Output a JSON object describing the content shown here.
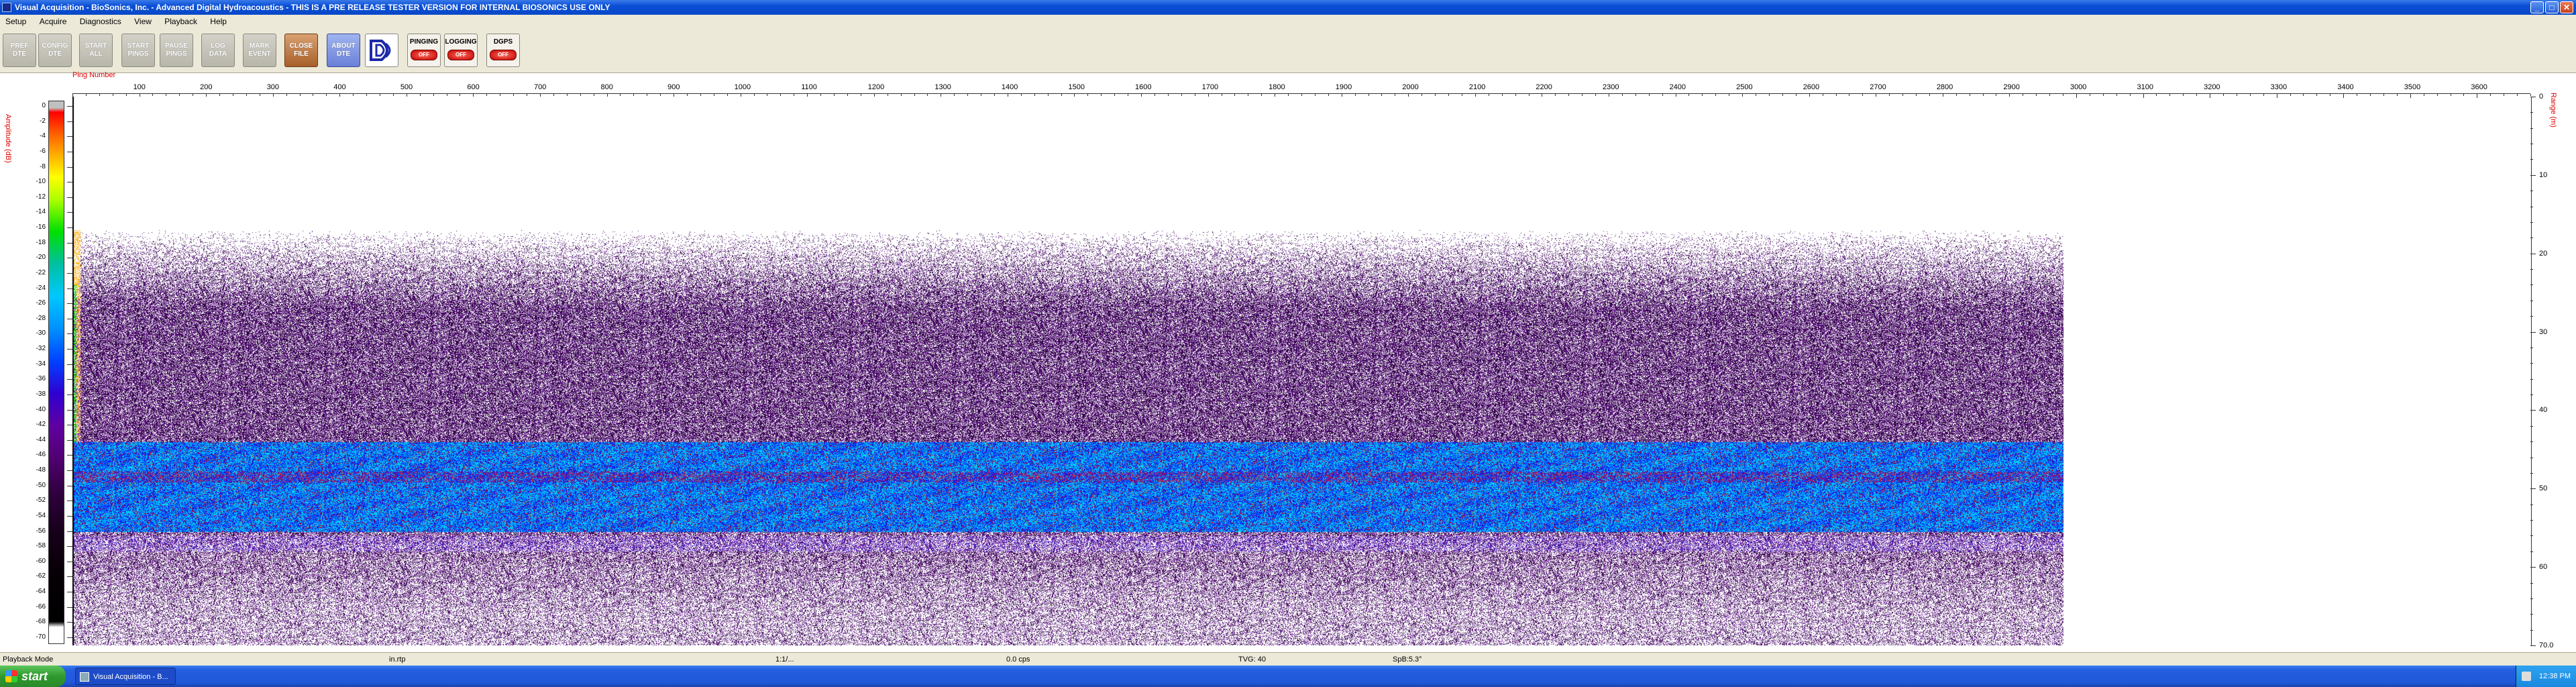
{
  "window": {
    "title": "Visual Acquisition  -  BioSonics, Inc.  -  Advanced Digital Hydroacoustics  -  THIS IS A PRE RELEASE TESTER VERSION FOR INTERNAL BIOSONICS USE ONLY",
    "minimize": "_",
    "maximize": "□",
    "close": "✕"
  },
  "menu": [
    "Setup",
    "Acquire",
    "Diagnostics",
    "View",
    "Playback",
    "Help"
  ],
  "toolbar": {
    "buttons": [
      {
        "id": "pref-dte",
        "line1": "PREF",
        "line2": "DTE",
        "style": "grey"
      },
      {
        "id": "config-dte",
        "line1": "CONFIG",
        "line2": "DTE",
        "style": "grey"
      },
      {
        "id": "start-all",
        "line1": "START",
        "line2": "ALL",
        "style": "grey"
      },
      {
        "id": "start-pings",
        "line1": "START",
        "line2": "PINGS",
        "style": "grey"
      },
      {
        "id": "pause-pings",
        "line1": "PAUSE",
        "line2": "PINGS",
        "style": "grey"
      },
      {
        "id": "log-data",
        "line1": "LOG",
        "line2": "DATA",
        "style": "grey"
      },
      {
        "id": "mark-event",
        "line1": "MARK",
        "line2": "EVENT",
        "style": "grey"
      },
      {
        "id": "close-file",
        "line1": "CLOSE",
        "line2": "FILE",
        "style": "orange"
      },
      {
        "id": "about-dte",
        "line1": "ABOUT",
        "line2": "DTE",
        "style": "blue"
      }
    ],
    "status": [
      {
        "id": "pinging",
        "label": "PINGING",
        "state": "OFF"
      },
      {
        "id": "logging",
        "label": "LOGGING",
        "state": "OFF"
      },
      {
        "id": "dgps",
        "label": "DGPS",
        "state": "OFF"
      }
    ]
  },
  "echogram": {
    "x_axis_title": "Ping Number",
    "x_ticks": [
      100,
      200,
      300,
      400,
      500,
      600,
      700,
      800,
      900,
      1000,
      1100,
      1200,
      1300,
      1400,
      1500,
      1600,
      1700,
      1800,
      1900,
      2000,
      2100,
      2200,
      2300,
      2400,
      2500,
      2600,
      2700,
      2800,
      2900,
      3000,
      3100,
      3200,
      3300,
      3400,
      3500,
      3600
    ],
    "x_max": 3680,
    "data_end_ping": 2965,
    "colorbar_title": "Amplitude (dB)",
    "colorbar_ticks": [
      "0",
      "-2",
      "-4",
      "-6",
      "-8",
      "-10",
      "-12",
      "-14",
      "-16",
      "-18",
      "-20",
      "-22",
      "-24",
      "-26",
      "-28",
      "-30",
      "-32",
      "-34",
      "-36",
      "-38",
      "-40",
      "-42",
      "-44",
      "-46",
      "-48",
      "-50",
      "-52",
      "-54",
      "-56",
      "-58",
      "-60",
      "-62",
      "-64",
      "-66",
      "-68",
      "-70"
    ],
    "range_title": "Range (m)",
    "range_ticks": [
      "0",
      "10",
      "20",
      "30",
      "40",
      "50",
      "60"
    ],
    "range_max": 70.0,
    "range_max_label": "70.0",
    "colors": {
      "purple": "#5a0f7a",
      "cyan": "#00c8ff",
      "blue": "#0028ff",
      "red": "#e00000"
    }
  },
  "status": {
    "mode": "Playback Mode",
    "f1": "in.rtp",
    "f2": "1:1/...",
    "f3": "0.0 cps",
    "f4": "TVG: 40",
    "f5": "SpB:5.3°"
  },
  "taskbar": {
    "start": "start",
    "task": "Visual Acquisition - B...",
    "clock": "12:38 PM"
  }
}
